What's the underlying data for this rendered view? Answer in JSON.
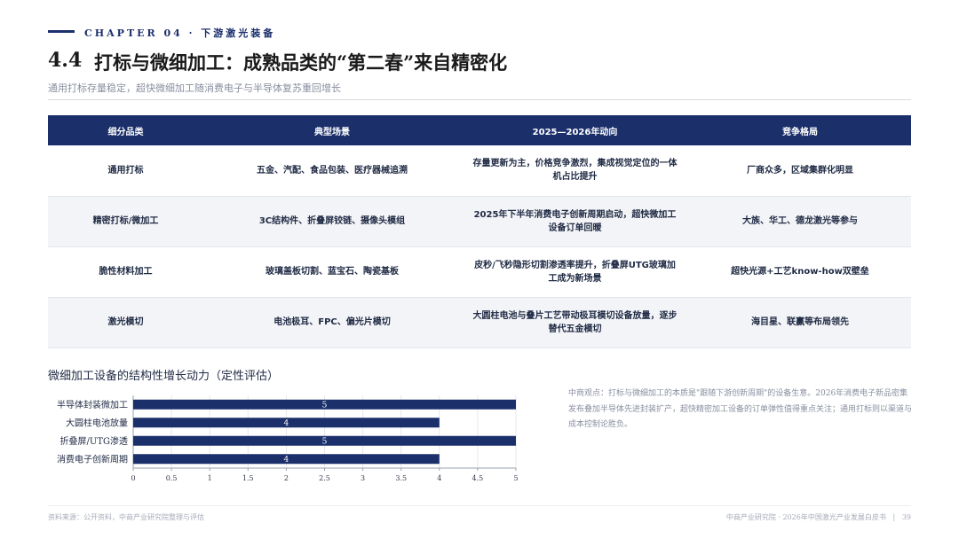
{
  "chapter": "CHAPTER 04 · 下游激光装备",
  "title": {
    "number": "4.4",
    "text": "打标与微细加工：成熟品类的“第二春”来自精密化"
  },
  "subtitle": "通用打标存量稳定，超快微细加工随消费电子与半导体复苏重回增长",
  "table": {
    "headers": [
      "细分品类",
      "典型场景",
      "2025—2026年动向",
      "竞争格局"
    ],
    "rows": [
      [
        "通用打标",
        "五金、汽配、食品包装、医疗器械追溯",
        "存量更新为主，价格竞争激烈，集成视觉定位的一体机占比提升",
        "厂商众多，区域集群化明显"
      ],
      [
        "精密打标/微加工",
        "3C结构件、折叠屏铰链、摄像头模组",
        "2025年下半年消费电子创新周期启动，超快微加工设备订单回暖",
        "大族、华工、德龙激光等参与"
      ],
      [
        "脆性材料加工",
        "玻璃盖板切割、蓝宝石、陶瓷基板",
        "皮秒/飞秒隐形切割渗透率提升，折叠屏UTG玻璃加工成为新场景",
        "超快光源+工艺know-how双壁垒"
      ],
      [
        "激光模切",
        "电池极耳、FPC、偏光片模切",
        "大圆柱电池与叠片工艺带动极耳模切设备放量，逐步替代五金模切",
        "海目星、联赢等布局领先"
      ]
    ]
  },
  "chart_title": "微细加工设备的结构性增长动力（定性评估）",
  "chart_data": {
    "type": "bar",
    "orientation": "horizontal",
    "categories": [
      "半导体封装微加工",
      "大圆柱电池放量",
      "折叠屏/UTG渗透",
      "消费电子创新周期"
    ],
    "values": [
      5,
      4,
      5,
      4
    ],
    "xlim": [
      0,
      5
    ],
    "xticks": [
      "0",
      "0.5",
      "1",
      "1.5",
      "2",
      "2.5",
      "3",
      "3.5",
      "4",
      "4.5",
      "5"
    ],
    "bar_color": "#1b2f6b",
    "grid": true
  },
  "note": "中商观点：打标与微细加工的本质是\"跟随下游创新周期\"的设备生意。2026年消费电子新品密集发布叠加半导体先进封装扩产，超快精密加工设备的订单弹性值得重点关注；通用打标则以渠道与成本控制论胜负。",
  "footer": {
    "source": "资料来源：公开资料，中商产业研究院整理与评估",
    "right": "中商产业研究院 · 2026年中国激光产业发展白皮书",
    "page": "39"
  },
  "colors": {
    "accent": "#1b2f6b",
    "row_alt": "#f3f4f7"
  }
}
